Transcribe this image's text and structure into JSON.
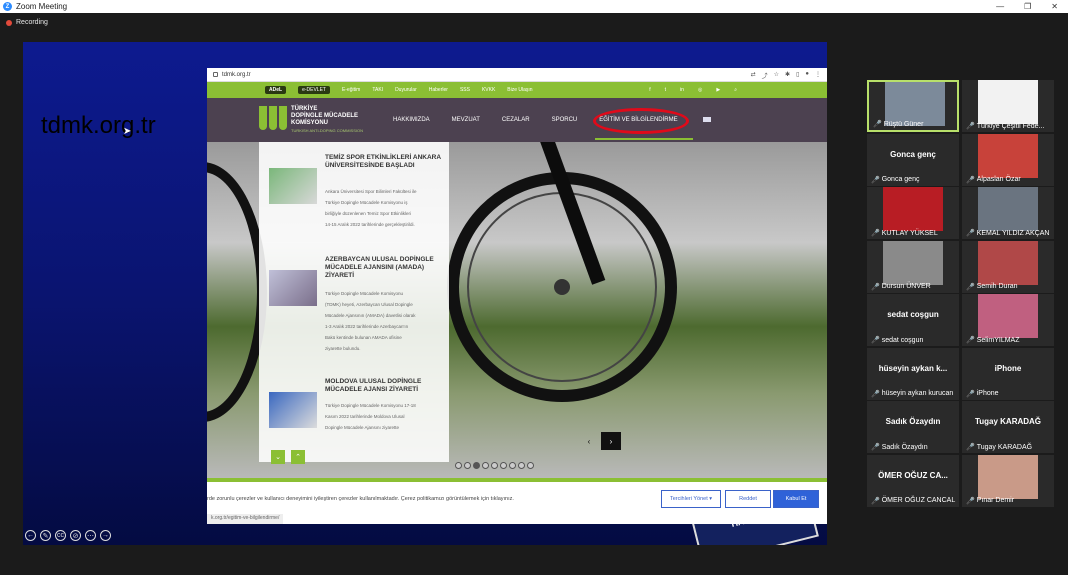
{
  "window": {
    "title": "Zoom Meeting",
    "recording": "Recording"
  },
  "share": {
    "overlay_url": "tdmk.org.tr",
    "browser_url": "tdmk.org.tr",
    "topnav": {
      "logo_pill": "ADeL",
      "pill2": "e-DEVLET",
      "links": [
        "E-eğitim",
        "TAKI",
        "Duyurular",
        "Haberler",
        "SSS",
        "KVKK",
        "Bize Ulaşın"
      ]
    },
    "brand": {
      "line1": "TÜRKİYE",
      "line2": "DOPİNGLE MÜCADELE",
      "line3": "KOMİSYONU",
      "sub": "TURKISH ANTI-DOPING COMMISSION"
    },
    "menu": [
      "HAKKIMIZDA",
      "MEVZUAT",
      "CEZALAR",
      "SPORCU",
      "EĞİTİM VE BİLGİLENDİRME"
    ],
    "news": [
      {
        "title": "TEMİZ SPOR ETKİNLİKLERİ ANKARA ÜNİVERSİTESİNDE BAŞLADI",
        "body": [
          "Ankara Üniversitesi Spor Bilimleri Fakültesi ile",
          "Türkiye Dopingle Mücadele Komisyonu iş",
          "birliğiyle düzenlenen Temiz Spor Etkinlikleri",
          "14-15 Aralık 2022 tarihlerinde gerçekleştirildi."
        ]
      },
      {
        "title": "AZERBAYCAN ULUSAL DOPİNGLE MÜCADELE AJANSINI (AMADA) ZİYARETİ",
        "body": [
          "Türkiye Dopingle Mücadele Komisyonu",
          "(TDMK) heyeti, Azerbaycan Ulusal Dopingle",
          "Mücadele Ajansının (AMADA) davetlisi olarak",
          "1-3 Aralık 2022 tarihlerinde Azerbaycan'ın",
          "Bakü kentinde bulunan AMADA ofisine",
          "ziyarette bulundu."
        ]
      },
      {
        "title": "MOLDOVA ULUSAL DOPİNGLE MÜCADELE AJANSI ZİYARETİ",
        "body": [
          "Türkiye Dopingle Mücadele Komisyonu 17-18",
          "Kasım 2022 tarihlerinde Moldova Ulusal",
          "Dopingle Mücadele Ajansını ziyarette"
        ]
      }
    ],
    "cookie": {
      "text": "rde zorunlu çerezler ve kullanıcı deneyimini iyileştiren çerezler kullanılmaktadır. Çerez politikamızı görüntülemek için tıklayınız.",
      "pref": "Tercihleri Yönet ▾",
      "reject": "Reddet",
      "accept": "Kabul Et"
    },
    "status_url": "k.org.tr/egitim-ve-bilgilendirme/",
    "banner_text": "HAT"
  },
  "participants": [
    {
      "name": "Rüştü Güner",
      "label": "",
      "video": true,
      "active": true,
      "color": "#7c8a9a"
    },
    {
      "name": "Türkiye Çeşitli Fede...",
      "label": "",
      "video": true,
      "active": false,
      "color": "#f2f2f2"
    },
    {
      "name": "Gonca genç",
      "label": "Gonca genç",
      "video": false,
      "active": false
    },
    {
      "name": "Alpaslan Özar",
      "label": "",
      "video": true,
      "active": false,
      "color": "#c8423a"
    },
    {
      "name": "KUTLAY YÜKSEL",
      "label": "",
      "video": true,
      "active": false,
      "color": "#b81d24"
    },
    {
      "name": "KEMAL YILDIZ AKÇAN",
      "label": "",
      "video": true,
      "active": false,
      "color": "#6a7480"
    },
    {
      "name": "Dursun ÜNVER",
      "label": "",
      "video": true,
      "active": false,
      "color": "#8a8a8a"
    },
    {
      "name": "Semih Duran",
      "label": "",
      "video": true,
      "active": false,
      "color": "#b04848"
    },
    {
      "name": "sedat coşgun",
      "label": "sedat coşgun",
      "video": false,
      "active": false
    },
    {
      "name": "SelimYILMAZ",
      "label": "",
      "video": true,
      "active": false,
      "color": "#c06080"
    },
    {
      "name": "hüseyin aykan kurucan",
      "label": "hüseyin aykan k...",
      "video": false,
      "active": false
    },
    {
      "name": "iPhone",
      "label": "iPhone",
      "video": false,
      "active": false
    },
    {
      "name": "Sadık Özaydın",
      "label": "Sadık Özaydın",
      "video": false,
      "active": false
    },
    {
      "name": "Tugay KARADAĞ",
      "label": "Tugay KARADAĞ",
      "video": false,
      "active": false
    },
    {
      "name": "ÖMER OĞUZ CANCAL",
      "label": "ÖMER OĞUZ CA...",
      "video": false,
      "active": false
    },
    {
      "name": "Pınar Demir",
      "label": "",
      "video": true,
      "active": false,
      "color": "#c99a88"
    }
  ]
}
